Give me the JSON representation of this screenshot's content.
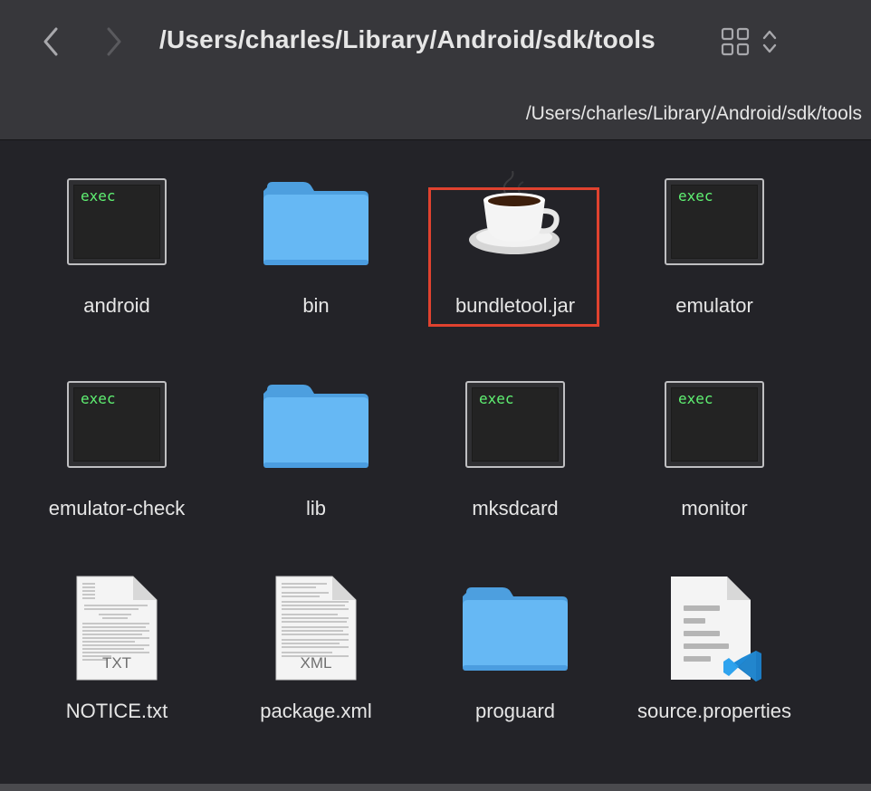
{
  "window": {
    "title": "/Users/charles/Library/Android/sdk/tools",
    "path_bar": "/Users/charles/Library/Android/sdk/tools"
  },
  "toolbar": {
    "back_icon": "chevron-left-icon",
    "forward_icon": "chevron-right-icon",
    "view_icon": "grid-view-icon",
    "view_menu_icon": "up-down-chevron-icon"
  },
  "files": [
    {
      "name": "android",
      "kind": "exec",
      "exec_label": "exec"
    },
    {
      "name": "bin",
      "kind": "folder"
    },
    {
      "name": "bundletool.jar",
      "kind": "jar",
      "selected": true
    },
    {
      "name": "emulator",
      "kind": "exec",
      "exec_label": "exec"
    },
    {
      "name": "emulator-check",
      "kind": "exec",
      "exec_label": "exec"
    },
    {
      "name": "lib",
      "kind": "folder"
    },
    {
      "name": "mksdcard",
      "kind": "exec",
      "exec_label": "exec"
    },
    {
      "name": "monitor",
      "kind": "exec",
      "exec_label": "exec"
    },
    {
      "name": "NOTICE.txt",
      "kind": "txt",
      "doc_label": "TXT"
    },
    {
      "name": "package.xml",
      "kind": "xml",
      "doc_label": "XML"
    },
    {
      "name": "proguard",
      "kind": "folder"
    },
    {
      "name": "source.properties",
      "kind": "vscode-doc"
    }
  ],
  "colors": {
    "toolbar_bg": "#37373b",
    "content_bg": "#232328",
    "text": "#e6e6e6",
    "folder_blue": "#66b8f4",
    "exec_green": "#5ff072",
    "selection_outline": "#e0422f",
    "vscode_blue": "#1f8ad6"
  }
}
